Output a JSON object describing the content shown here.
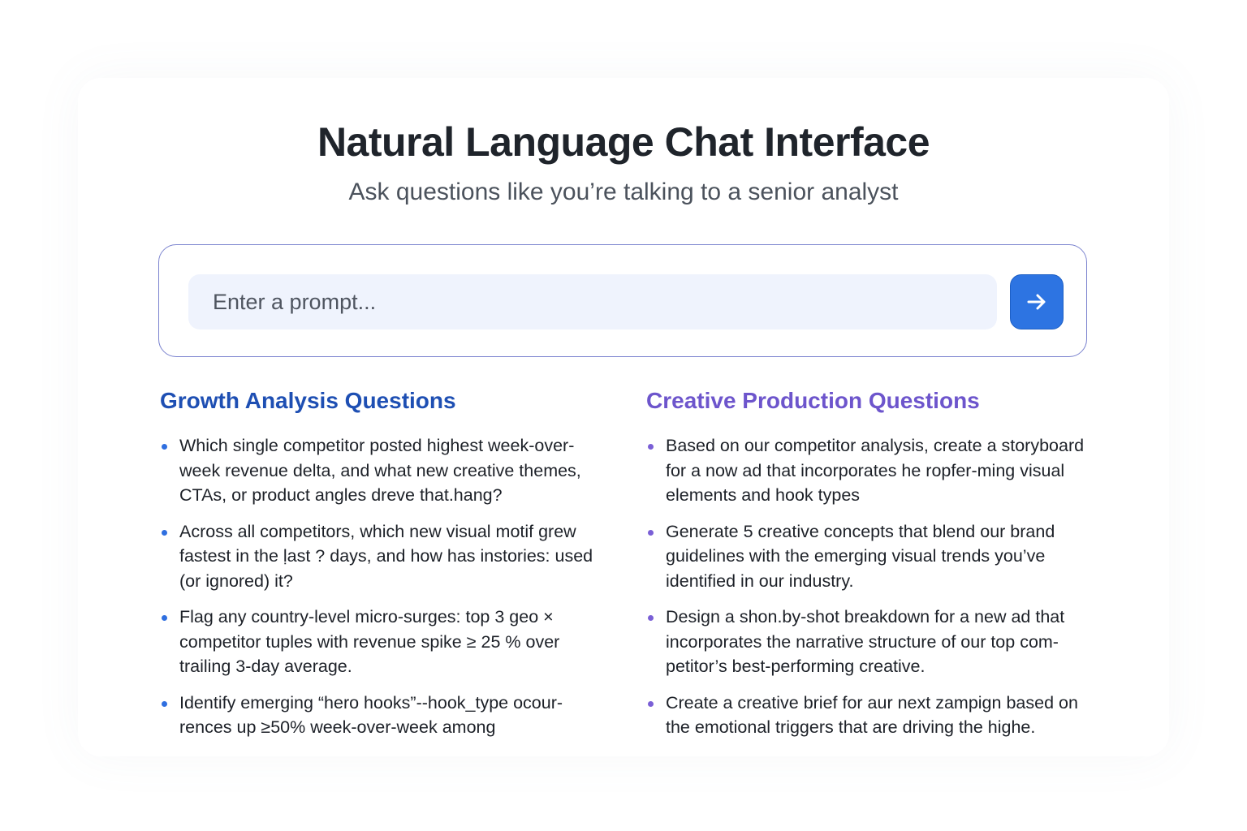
{
  "header": {
    "title": "Natural Language Chat Interface",
    "subtitle": "Ask questions like you’re talking to a senior analyst"
  },
  "prompt": {
    "placeholder": "Enter a prompt...",
    "value": "",
    "send_icon": "arrow-right-icon"
  },
  "colors": {
    "accent_blue": "#2d74e2",
    "growth_heading": "#1e4fb3",
    "creative_heading": "#6d55cc",
    "prompt_border": "#7b83cf",
    "input_background": "#eff3fd"
  },
  "growth": {
    "heading": "Growth Analysis Questions",
    "items": [
      "Which single competitor posted highest  week-over-week revenue delta, and what new creative themes, CTAs, or product angles dreve that.hang?",
      "Across all competitors, which new visual motif grew fastest in the ḷast ? days, and how has instories: used (or ignored) it?",
      "Flag any country-level micro-surges: top 3 geo × competitor tuples with revenue spike ≥ 25 % over trailing 3-day average.",
      "Identify emerging  “hero hooks”--hook_type ocour-rences up ≥50% week-over-week among"
    ]
  },
  "creative": {
    "heading": "Creative Production Questions",
    "items": [
      "Based on our competitor analysis, create a storyboard for a now ad that incorporates he ropfer-ming visual elements and hook types",
      "Generate 5 creative concepts that blend our brand guidelines with the emerging visual trends you’ve identified in our industry.",
      "Design a shon.by-shot breakdown for a new ad that incorporates the narrative structure of our top com-petitor’s best-performing creative.",
      "Create a creative brief for aur next zampign based on the emotional triggers that are driving the highe."
    ]
  }
}
